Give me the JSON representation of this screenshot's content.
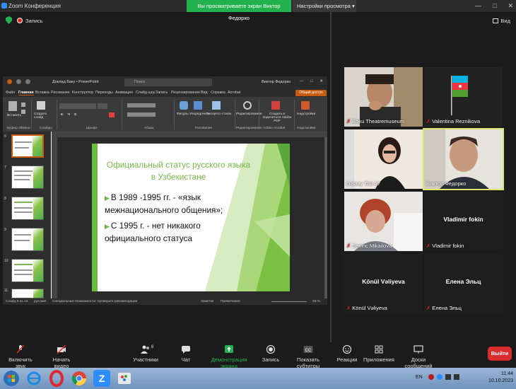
{
  "titlebar": {
    "app_title": "Zoom Конференция",
    "share_banner": "Вы просматриваете экран Виктор Федорко",
    "view_settings": "Настройки просмотра",
    "controls": [
      "—",
      "□",
      "✕"
    ]
  },
  "topbar": {
    "recording_label": "Запись",
    "view_label": "Вид"
  },
  "powerpoint": {
    "doc_title": "Доклад Баку • PowerPoint",
    "search_placeholder": "Поиск",
    "user": "Виктор Федорко",
    "share_label": "Общий доступ",
    "tabs": [
      "Файл",
      "Главная",
      "Вставка",
      "Рисование",
      "Конструктор",
      "Переходы",
      "Анимация",
      "Слайд-шоу",
      "Запись",
      "Рецензирование",
      "Вид",
      "Справка",
      "Acrobat"
    ],
    "ribbon": {
      "paste": "Вставить",
      "new_slide": "Создать слайд",
      "groups": [
        "Буфер обмена",
        "Слайды",
        "Шрифт",
        "Абзац",
        "Рисование",
        "Редактирование",
        "Adobe Acrobat",
        "Надстройки"
      ],
      "shapes": "Фигуры",
      "arrange": "Упорядочить",
      "quick_styles": "Экспресс-стили",
      "editing": "Редактирование",
      "acrobat": "Создать и поделиться Adobe PDF",
      "addins": "Надстройки"
    },
    "thumb_numbers": [
      "6",
      "7",
      "8",
      "9",
      "10",
      "11"
    ],
    "status": {
      "slide": "Слайд 6 из 13",
      "lang": "русский",
      "accessibility": "Специальные возможности: проверьте рекомендации",
      "notes": "Заметки",
      "comments": "Примечания",
      "zoom": "65 %"
    },
    "slide": {
      "title": "Официальный статус русского языка в Узбекистане",
      "bullets": [
        "В 1989 -1995 гг. - «язык межнационального общения»;",
        "С 1995 г. - нет никакого официального статуса"
      ]
    }
  },
  "participants": [
    {
      "name": "Baku Theatremuseum",
      "muted": true
    },
    {
      "name": "Valentina Reznikova",
      "muted": true
    },
    {
      "name": "Galaxy Tab A7",
      "muted": false
    },
    {
      "name": "Виктор Федорко",
      "muted": false
    },
    {
      "name": "Sevinc Mikailova",
      "muted": true
    },
    {
      "name": "Vladimir fokin",
      "muted": true,
      "big": "Vladimir fokin"
    },
    {
      "name": "Könül Vəliyeva",
      "muted": true,
      "big": "Könül Vəliyeva"
    },
    {
      "name": "Елена Эльц",
      "muted": true,
      "big": "Елена Эльц"
    }
  ],
  "toolbar": {
    "audio": "Включить звук",
    "video": "Начать видео",
    "participants": "Участники",
    "participants_count": "8",
    "chat": "Чат",
    "share": "Демонстрация экрана",
    "record": "Запись",
    "subtitles": "Показать субтитры",
    "reactions": "Реакции",
    "apps": "Приложения",
    "whiteboards": "Доски сообщений",
    "exit": "Выйти"
  },
  "taskbar": {
    "lang": "EN",
    "time": "11:44",
    "date": "10.10.2023"
  },
  "colors": {
    "share_green": "#23b14d",
    "slide_green": "#6cbb3c",
    "exit_red": "#d92e2e",
    "ppt_accent": "#c55a11"
  }
}
